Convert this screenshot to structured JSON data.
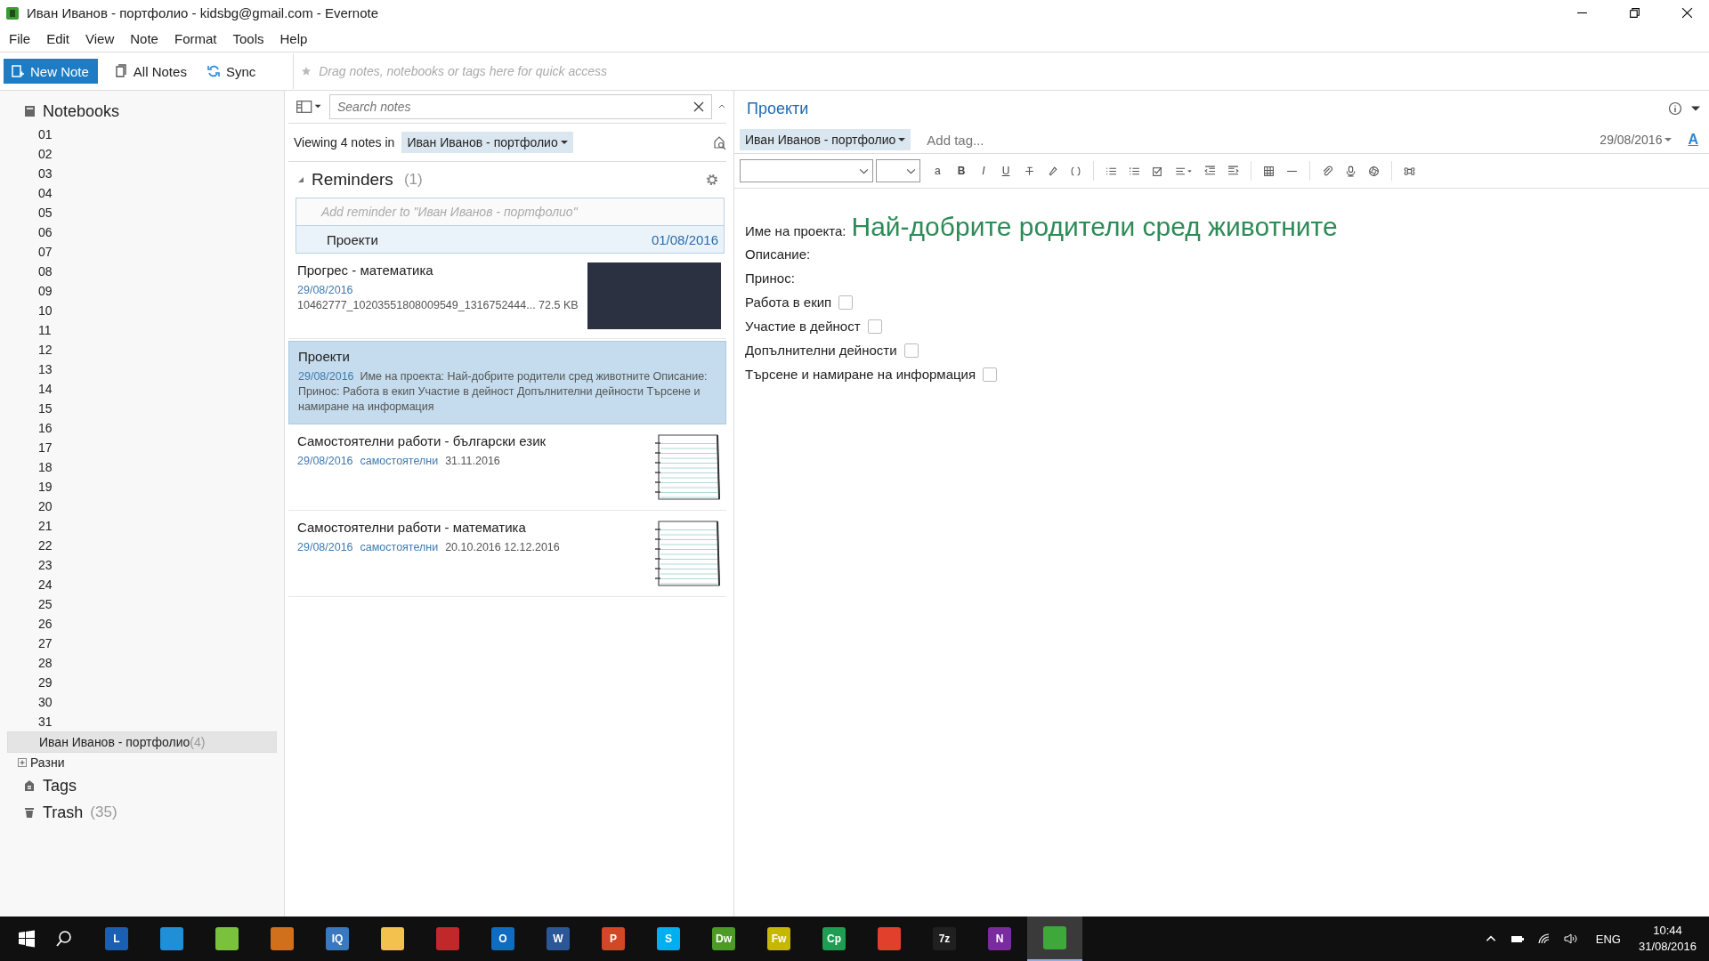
{
  "window": {
    "title": "Иван Иванов - портфолио - kidsbg@gmail.com - Evernote"
  },
  "menu": [
    "File",
    "Edit",
    "View",
    "Note",
    "Format",
    "Tools",
    "Help"
  ],
  "toolbar": {
    "new_note": "New Note",
    "all_notes": "All Notes",
    "sync": "Sync",
    "shortcuts_placeholder": "Drag notes, notebooks or tags here for quick access"
  },
  "sidebar": {
    "notebooks_label": "Notebooks",
    "notebooks": [
      {
        "name": "01",
        "selected": false
      },
      {
        "name": "02",
        "selected": false
      },
      {
        "name": "03",
        "selected": false
      },
      {
        "name": "04",
        "selected": false
      },
      {
        "name": "05",
        "selected": false
      },
      {
        "name": "06",
        "selected": false
      },
      {
        "name": "07",
        "selected": false
      },
      {
        "name": "08",
        "selected": false
      },
      {
        "name": "09",
        "selected": false
      },
      {
        "name": "10",
        "selected": false
      },
      {
        "name": "11",
        "selected": false
      },
      {
        "name": "12",
        "selected": false
      },
      {
        "name": "13",
        "selected": false
      },
      {
        "name": "14",
        "selected": false
      },
      {
        "name": "15",
        "selected": false
      },
      {
        "name": "16",
        "selected": false
      },
      {
        "name": "17",
        "selected": false
      },
      {
        "name": "18",
        "selected": false
      },
      {
        "name": "19",
        "selected": false
      },
      {
        "name": "20",
        "selected": false
      },
      {
        "name": "21",
        "selected": false
      },
      {
        "name": "22",
        "selected": false
      },
      {
        "name": "23",
        "selected": false
      },
      {
        "name": "24",
        "selected": false
      },
      {
        "name": "25",
        "selected": false
      },
      {
        "name": "26",
        "selected": false
      },
      {
        "name": "27",
        "selected": false
      },
      {
        "name": "28",
        "selected": false
      },
      {
        "name": "29",
        "selected": false
      },
      {
        "name": "30",
        "selected": false
      },
      {
        "name": "31",
        "selected": false
      },
      {
        "name": "Иван Иванов - портфолио",
        "count": "(4)",
        "selected": true
      }
    ],
    "stack": {
      "name": "Разни",
      "expanded": false
    },
    "tags_label": "Tags",
    "trash_label": "Trash",
    "trash_count": "(35)"
  },
  "note_list": {
    "search": {
      "placeholder": "Search notes"
    },
    "viewing": "Viewing 4 notes in",
    "notebook": "Иван Иванов - портфолио",
    "reminders": {
      "label": "Reminders",
      "count": "(1)",
      "expanded": true,
      "placeholder": "Add reminder to \"Иван Иванов - портфолио\"",
      "items": [
        {
          "title": "Проекти",
          "date": "01/08/2016"
        }
      ]
    },
    "notes": [
      {
        "kind": "photo",
        "title": "Прогрес - математика",
        "date": "29/08/2016",
        "snippet": "10462777_10203551808009549_1316752444...   72.5 KB",
        "selected": false
      },
      {
        "kind": "text",
        "title": "Проекти",
        "date": "29/08/2016",
        "snippet": "Име на проекта: Най-добрите родители сред животните Описание: Принос: Работа в екип Участие в дейност Допълнителни дейности Търсене и намиране на информация",
        "selected": true
      },
      {
        "kind": "notepad",
        "title": "Самостоятелни работи - български език",
        "date": "29/08/2016",
        "tag": "самостоятелни",
        "snippet": "31.11.2016",
        "selected": false
      },
      {
        "kind": "notepad",
        "title": "Самостоятелни работи - математика",
        "date": "29/08/2016",
        "tag": "самостоятелни",
        "snippet": "20.10.2016 12.12.2016",
        "selected": false
      }
    ]
  },
  "editor": {
    "title": "Проекти",
    "notebook": "Иван Иванов - портфолио",
    "tag_placeholder": "Add tag...",
    "date": "29/08/2016",
    "font_color_button": "A",
    "format_buttons": [
      "a",
      "B",
      "I",
      "U"
    ],
    "body": {
      "heading_label": "Име на проекта:",
      "heading": "Най-добрите родители сред животните",
      "lines": [
        {
          "kind": "text",
          "text": "Описание:"
        },
        {
          "kind": "text",
          "text": "Принос:"
        },
        {
          "kind": "check",
          "text": "Работа в екип",
          "checked": false
        },
        {
          "kind": "check",
          "text": "Участие в дейност",
          "checked": false
        },
        {
          "kind": "check",
          "text": "Допълнителни дейности",
          "checked": false
        },
        {
          "kind": "check",
          "text": "Търсене и намиране на информация",
          "checked": false
        }
      ]
    }
  },
  "taskbar": {
    "apps": [
      {
        "label": "L",
        "color": "#1b5fb0",
        "active": false
      },
      {
        "color": "#1f8fd8",
        "active": false
      },
      {
        "color": "#7ac13e",
        "active": false
      },
      {
        "color": "#d0701c",
        "active": false
      },
      {
        "label": "IQ",
        "color": "#3a78c0",
        "active": false
      },
      {
        "color": "#f2c14e",
        "active": false
      },
      {
        "color": "#c0282a",
        "active": false
      },
      {
        "label": "O",
        "color": "#0f6cc0",
        "active": false
      },
      {
        "label": "W",
        "color": "#2b5797",
        "active": false
      },
      {
        "label": "P",
        "color": "#d24726",
        "active": false
      },
      {
        "label": "S",
        "color": "#00aff0",
        "active": false
      },
      {
        "label": "Dw",
        "color": "#4d9a26",
        "active": false
      },
      {
        "label": "Fw",
        "color": "#c6b800",
        "active": false
      },
      {
        "label": "Cp",
        "color": "#1e9e52",
        "active": false
      },
      {
        "color": "#e0402c",
        "active": false
      },
      {
        "label": "7z",
        "color": "#202020",
        "active": false
      },
      {
        "label": "N",
        "color": "#7a2c9e",
        "active": false
      },
      {
        "color": "#3fa83a",
        "active": true
      }
    ],
    "language": "ENG",
    "time": "10:44",
    "date": "31/08/2016"
  }
}
